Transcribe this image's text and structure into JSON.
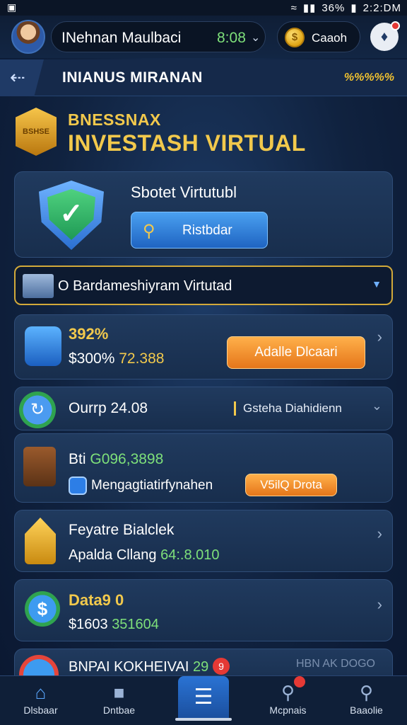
{
  "status_bar": {
    "left_icon": "▣",
    "battery": "36%",
    "time": "2:2:DM"
  },
  "header": {
    "user_name": "INehnan Maulbaci",
    "user_score": "8:08",
    "coin_label": "Caaoh"
  },
  "navbar": {
    "title": "INIANUS MIRANAN",
    "right_text": "%%%%%"
  },
  "title_block": {
    "subtitle": "BNESSNAX",
    "title": "INVESTASH VIRTUAL",
    "badge_text": "BSHSE"
  },
  "security_card": {
    "title": "Sbotet Virtutubl",
    "button_label": "Ristbdar"
  },
  "dropdown": {
    "label": "O Bardameshiyram Virtutad"
  },
  "items": {
    "item1": {
      "percent": "392%",
      "value_prefix": "$300%",
      "value_gain": "72.388",
      "button_label": "Adalle Dlcaari"
    },
    "item2": {
      "label": "Ourrp 24.08",
      "tag": "Gsteha Diahidienn"
    },
    "item3": {
      "prefix": "Bti",
      "value": "G096,3898",
      "sub_label": "Mengagtiatirfynahen",
      "button_label": "V5ilQ Drota"
    },
    "item4": {
      "title": "Feyatre Bialclek",
      "sub_label": "Apalda Cllang",
      "sub_value": "64:.8.010"
    },
    "item5": {
      "title": "Data9 0",
      "value_prefix": "$1603",
      "value_gain": "351604"
    },
    "item6": {
      "title": "BNPAI KOKHEIVAI",
      "title_gain": "29",
      "badge": "9",
      "right": "HBN AK DOGO"
    }
  },
  "bottom_nav": {
    "tabs": [
      {
        "label": "Dlsbaar"
      },
      {
        "label": "Dntbae"
      },
      {
        "label": ""
      },
      {
        "label": "Mcpnais"
      },
      {
        "label": "Baaolie"
      }
    ]
  },
  "colors": {
    "accent_gold": "#f2c94c",
    "accent_green": "#7ee07a",
    "accent_blue": "#2a73d4",
    "accent_orange": "#e5761a"
  }
}
